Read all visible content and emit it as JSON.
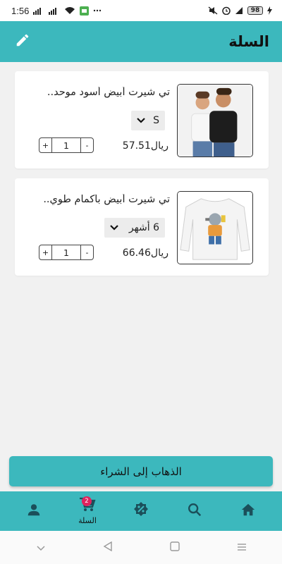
{
  "status_bar": {
    "time": "1:56",
    "battery": "98"
  },
  "header": {
    "title": "السلة",
    "edit_icon": "pencil-icon"
  },
  "cart_items": [
    {
      "title": "تي شيرت أبيض أسود موحد..",
      "size": "S",
      "price": "57.51ريال",
      "quantity": "1",
      "plus": "+",
      "minus": "-"
    },
    {
      "title": "تي شيرت أبيض بأكمام طوي..",
      "size": "6 أشهر",
      "price": "66.46ريال",
      "quantity": "1",
      "plus": "+",
      "minus": "-"
    }
  ],
  "checkout": {
    "label": "الذهاب إلى الشراء"
  },
  "bottom_nav": {
    "items": [
      {
        "icon": "profile-icon",
        "label": ""
      },
      {
        "icon": "cart-icon",
        "label": "السلة",
        "badge": "2"
      },
      {
        "icon": "discount-icon",
        "label": ""
      },
      {
        "icon": "search-icon",
        "label": ""
      },
      {
        "icon": "home-icon",
        "label": ""
      }
    ]
  },
  "colors": {
    "accent": "#3cb8bd",
    "badge": "#e0245e"
  }
}
